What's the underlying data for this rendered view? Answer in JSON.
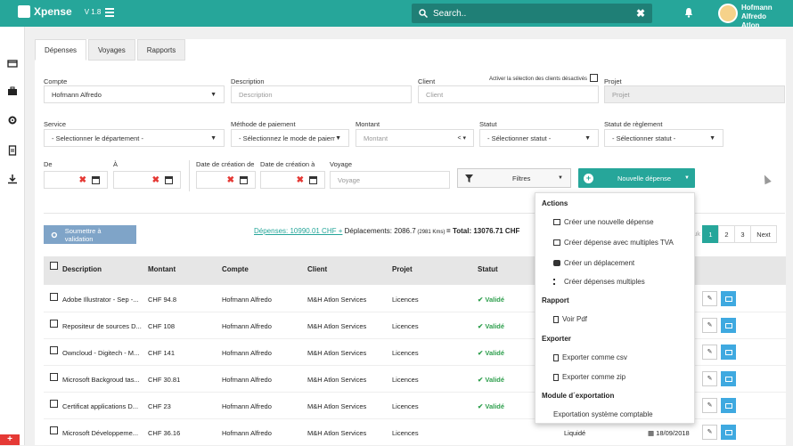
{
  "app": {
    "name": "Xpense",
    "version": "V 1.8"
  },
  "search": {
    "text": "Search..",
    "clear": "✖"
  },
  "user": {
    "name": "Hofmann Alfredo",
    "company": "Atlon"
  },
  "tabs": [
    {
      "label": "Dépenses"
    },
    {
      "label": "Voyages"
    },
    {
      "label": "Rapports"
    }
  ],
  "form": {
    "compte": {
      "label": "Compte",
      "value": "Hofmann Alfredo"
    },
    "description": {
      "label": "Description",
      "placeholder": "Description"
    },
    "client": {
      "label": "Client",
      "placeholder": "Client",
      "deactivated": "Activer la sélection des clients désactivés"
    },
    "projet": {
      "label": "Projet",
      "placeholder": "Projet"
    },
    "service": {
      "label": "Service",
      "value": "- Selectionner le département -"
    },
    "methode": {
      "label": "Méthode de paiement",
      "value": "- Sélectionnez le mode de paiem"
    },
    "montant": {
      "label": "Montant",
      "placeholder": "Montant",
      "op": "<"
    },
    "statut": {
      "label": "Statut",
      "value": "- Sélectionner statut -"
    },
    "statut_reglement": {
      "label": "Statut de règlement",
      "value": "- Sélectionner statut -"
    },
    "de": {
      "label": "De"
    },
    "a": {
      "label": "À"
    },
    "date_creation_de": {
      "label": "Date de création de"
    },
    "date_creation_a": {
      "label": "Date de création à"
    },
    "voyage": {
      "label": "Voyage",
      "placeholder": "Voyage"
    }
  },
  "buttons": {
    "filtres": "Filtres",
    "nouvelle": "Nouvelle dépense",
    "soumettre": "Soumettre à validation"
  },
  "summary": {
    "depenses": "Dépenses: 10990.01 CHF +",
    "deplacements": " Déplacements: 2086.7",
    "kms": " (2981 Kms) ",
    "total": "= Total: 13076.71 CHF"
  },
  "pager": {
    "prev": "uk",
    "pages": [
      "1",
      "2",
      "3"
    ],
    "next": "Next"
  },
  "table": {
    "headers": {
      "description": "Description",
      "montant": "Montant",
      "compte": "Compte",
      "client": "Client",
      "projet": "Projet",
      "statut": "Statut"
    },
    "rows": [
      {
        "description": "Adobe Illustrator - Sep -...",
        "montant": "CHF 94.8",
        "compte": "Hofmann Alfredo",
        "client": "M&H Atlon Services",
        "projet": "Licences",
        "statut": "Validé",
        "date": ""
      },
      {
        "description": "Repositeur de sources D...",
        "montant": "CHF 108",
        "compte": "Hofmann Alfredo",
        "client": "M&H Atlon Services",
        "projet": "Licences",
        "statut": "Validé",
        "date": ""
      },
      {
        "description": "Owncloud - Digitech - M...",
        "montant": "CHF 141",
        "compte": "Hofmann Alfredo",
        "client": "M&H Atlon Services",
        "projet": "Licences",
        "statut": "Validé",
        "date": ""
      },
      {
        "description": "Microsoft Backgroud tas...",
        "montant": "CHF 30.81",
        "compte": "Hofmann Alfredo",
        "client": "M&H Atlon Services",
        "projet": "Licences",
        "statut": "Validé",
        "date": ""
      },
      {
        "description": "Certificat applications D...",
        "montant": "CHF 23",
        "compte": "Hofmann Alfredo",
        "client": "M&H Atlon Services",
        "projet": "Licences",
        "statut": "Validé",
        "date": ""
      },
      {
        "description": "Microsoft Développeme...",
        "montant": "CHF 36.16",
        "compte": "Hofmann Alfredo",
        "client": "M&H Atlon Services",
        "projet": "Licences",
        "statut": "Liquidé",
        "date": "18/09/2018"
      }
    ]
  },
  "menu": {
    "actions_title": "Actions",
    "creer_depense": "Créer une nouvelle dépense",
    "creer_tva": "Créer dépense avec multiples TVA",
    "creer_deplacement": "Créer un déplacement",
    "creer_multiples": "Créer dépenses multiples",
    "rapport_title": "Rapport",
    "voir_pdf": "Voir Pdf",
    "exporter_title": "Exporter",
    "export_csv": "Exporter comme csv",
    "export_zip": "Exporter comme zip",
    "module_title": "Module d´exportation",
    "export_comptable": "Exportation système comptable"
  },
  "colors": {
    "accent": "#26a69a",
    "valid": "#2e9f4d",
    "danger": "#e53935"
  }
}
